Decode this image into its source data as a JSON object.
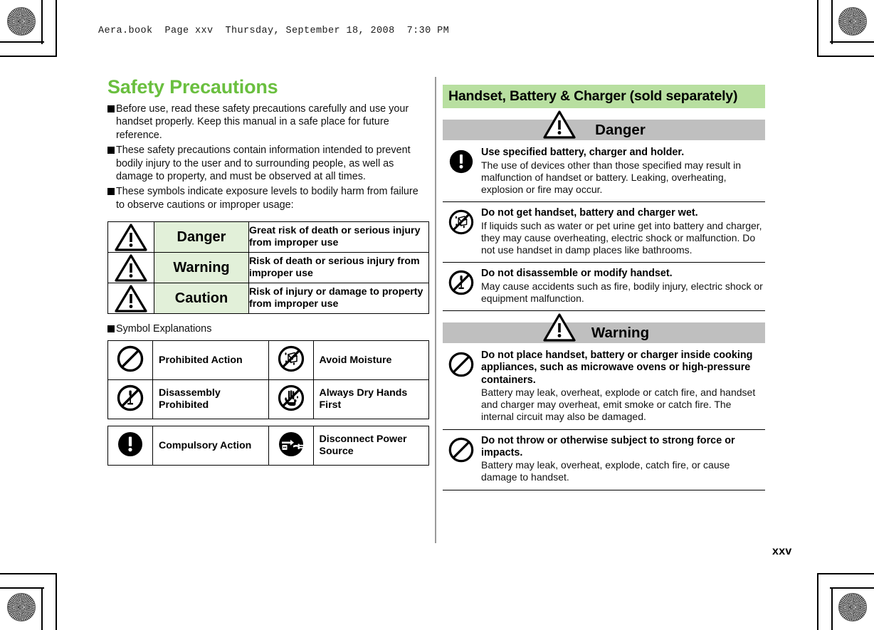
{
  "print_header": {
    "text": "Aera.book  Page xxv  Thursday, September 18, 2008  7:30 PM"
  },
  "colors": {
    "title_green": "#6abf3f",
    "banner_green": "#b8dfa0",
    "table_label_green": "#e2f0d9",
    "section_bar_gray": "#bfbfbf"
  },
  "left_column": {
    "title": "Safety Precautions",
    "intro_bullets": [
      "Before use, read these safety precautions carefully and use your handset properly. Keep this manual in a safe place for future reference.",
      "These safety precautions contain information intended to prevent bodily injury to the user and to surrounding people, as well as damage to property, and must be observed at all times.",
      "These symbols indicate exposure levels to bodily harm from failure to observe cautions or improper usage:"
    ],
    "level_table": {
      "rows": [
        {
          "icon": "warning-triangle-icon",
          "label": "Danger",
          "description": "Great risk of death or serious injury from improper use"
        },
        {
          "icon": "warning-triangle-icon",
          "label": "Warning",
          "description": "Risk of death or serious injury from improper use"
        },
        {
          "icon": "warning-triangle-icon",
          "label": "Caution",
          "description": "Risk of injury or damage to property from improper use"
        }
      ]
    },
    "symbol_section_heading": "Symbol Explanations",
    "symbol_table_top": {
      "rows": [
        {
          "left_icon": "prohibition-circle-icon",
          "left_label": "Prohibited Action",
          "right_icon": "avoid-moisture-icon",
          "right_label": "Avoid Moisture"
        },
        {
          "left_icon": "disassembly-prohibited-icon",
          "left_label": "Disassembly Prohibited",
          "right_icon": "dry-hands-icon",
          "right_label": "Always Dry Hands First"
        }
      ]
    },
    "symbol_table_bottom": {
      "rows": [
        {
          "left_icon": "compulsory-action-icon",
          "left_label": "Compulsory Action",
          "right_icon": "disconnect-power-icon",
          "right_label": "Disconnect Power Source"
        }
      ]
    }
  },
  "right_column": {
    "banner": "Handset, Battery & Charger (sold separately)",
    "sections": [
      {
        "heading": "Danger",
        "heading_icon": "warning-triangle-icon",
        "entries": [
          {
            "icon": "compulsory-action-icon",
            "title": "Use specified battery, charger and holder.",
            "body": "The use of devices other than those specified may result in malfunction of handset or battery. Leaking, overheating, explosion or fire may occur."
          },
          {
            "icon": "avoid-moisture-icon",
            "title": "Do not get handset, battery and charger wet.",
            "body": "If liquids such as water or pet urine get into battery and charger, they may cause overheating, electric shock or malfunction. Do not use handset in damp places like bathrooms."
          },
          {
            "icon": "disassembly-prohibited-icon",
            "title": "Do not disassemble or modify handset.",
            "body": "May cause accidents such as fire, bodily injury, electric shock or equipment malfunction."
          }
        ]
      },
      {
        "heading": "Warning",
        "heading_icon": "warning-triangle-icon",
        "entries": [
          {
            "icon": "prohibition-circle-icon",
            "title": "Do not place handset, battery or charger inside cooking appliances, such as microwave ovens or high-pressure containers.",
            "body": "Battery may leak, overheat, explode or catch fire, and handset and charger may overheat, emit smoke or catch fire. The internal circuit may also be damaged."
          },
          {
            "icon": "prohibition-circle-icon",
            "title": "Do not throw or otherwise subject to strong force or impacts.",
            "body": "Battery may leak, overheat, explode, catch fire, or cause damage to handset."
          }
        ]
      }
    ]
  },
  "footer": {
    "page_number": "xxv"
  }
}
